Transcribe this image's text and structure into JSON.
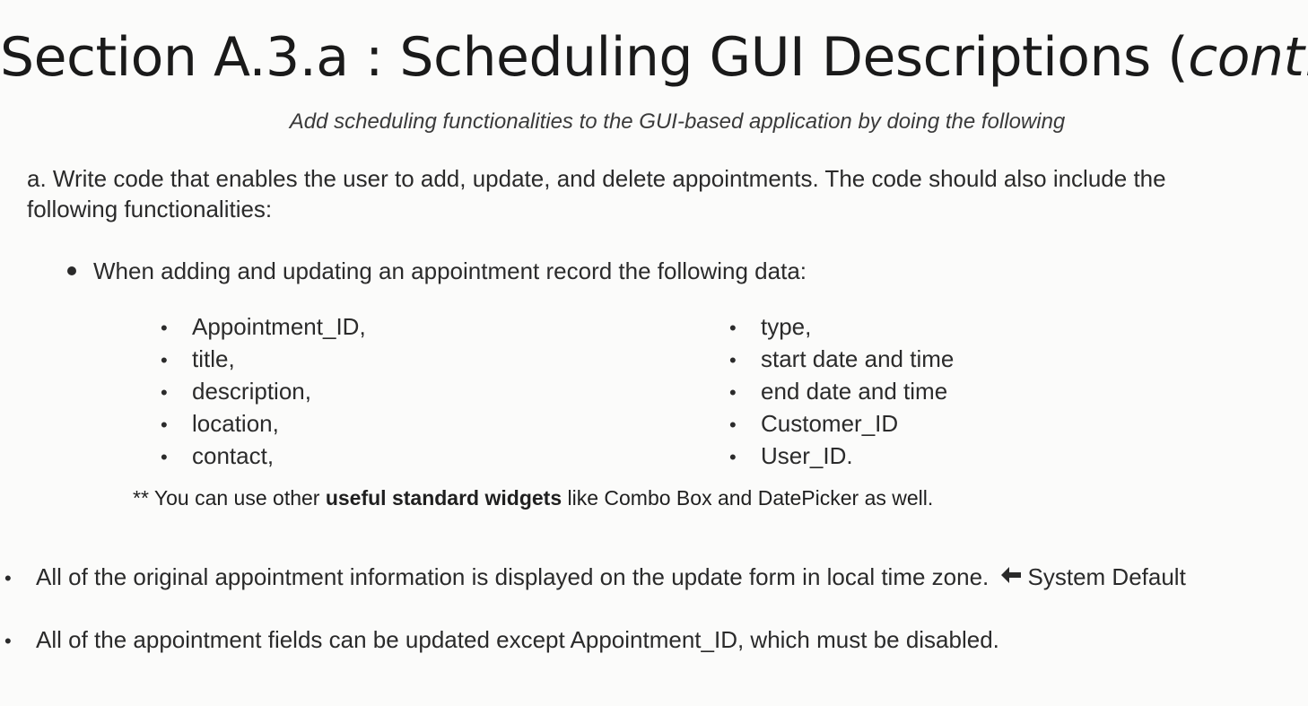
{
  "title": {
    "main": "Section A.3.a : Scheduling GUI Descriptions (",
    "cont": "cont.",
    "close": ")"
  },
  "subtitle": "Add scheduling functionalities to the GUI-based application by doing the following",
  "intro": {
    "line1": "a.  Write code that enables the user to add, update, and delete appointments. The code should also include the",
    "line2": "following functionalities:"
  },
  "main_bullet": "When adding and updating an appointment record the following data:",
  "fields_col1": [
    "Appointment_ID,",
    "title,",
    "description,",
    "location,",
    "contact,"
  ],
  "fields_col2": [
    "type,",
    "start date and time",
    "end date and time",
    "Customer_ID",
    "User_ID."
  ],
  "note": {
    "prefix": "** You can use other ",
    "bold": "useful standard widgets",
    "suffix": " like Combo Box and  DatePicker as well."
  },
  "requirements": [
    {
      "text": "All of the original appointment information is displayed on the update form in local time zone.",
      "suffix": "System Default",
      "icon": "left-arrow-icon"
    },
    {
      "text": "All of the appointment fields can be updated except Appointment_ID, which must be disabled."
    }
  ],
  "bullet_char": "•"
}
